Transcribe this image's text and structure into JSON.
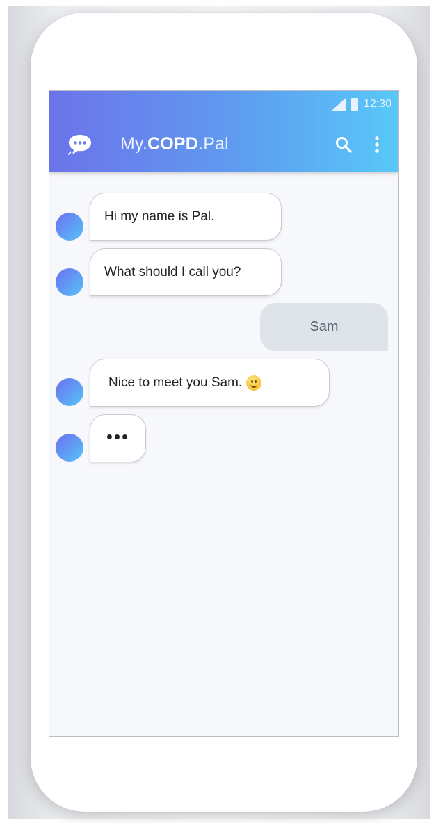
{
  "status_bar": {
    "time": "12:30"
  },
  "app_bar": {
    "title_prefix": "My.",
    "title_bold": "COPD",
    "title_suffix": ".Pal"
  },
  "messages": [
    {
      "sender": "bot",
      "text": "Hi my name is Pal."
    },
    {
      "sender": "bot",
      "text": "What should I call you?"
    },
    {
      "sender": "user",
      "text": "Sam"
    },
    {
      "sender": "bot",
      "text": "Nice to meet you Sam."
    },
    {
      "sender": "bot",
      "text": "•••"
    }
  ],
  "colors": {
    "appbar_start": "#6c73ea",
    "appbar_end": "#58c8f8",
    "user_bubble": "#dfe3ea",
    "screen_bg": "#f7f8fb"
  },
  "icons": [
    "signal-icon",
    "battery-icon",
    "chat-bubble-icon",
    "search-icon",
    "more-vert-icon",
    "smile-emoji-icon"
  ]
}
